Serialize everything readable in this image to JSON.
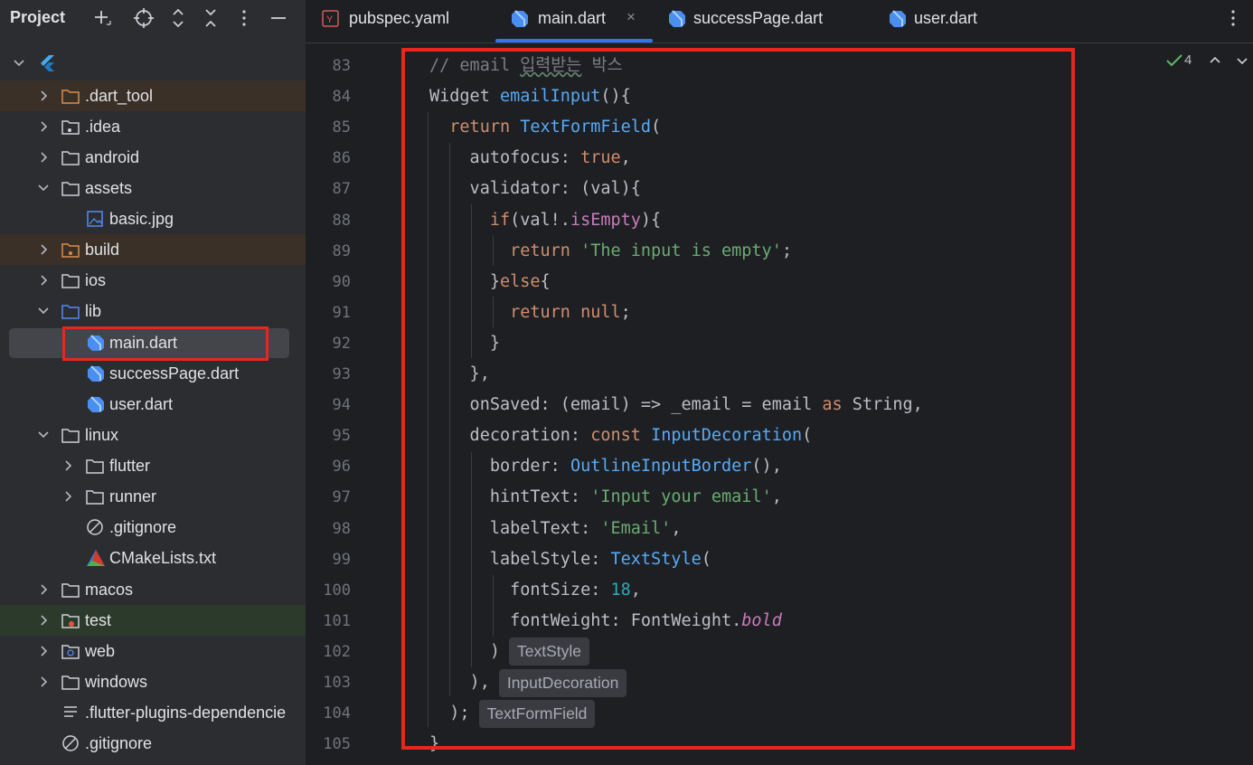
{
  "project_panel": {
    "title": "Project",
    "header_icons": [
      "add-icon",
      "target-icon",
      "expand-icon",
      "collapse-icon",
      "more-vertical-icon",
      "minimize-icon"
    ],
    "tree": [
      {
        "label": "",
        "icon": "flutter-icon",
        "expanded": true
      },
      {
        "label": ".dart_tool",
        "icon": "folder-excluded-icon",
        "expanded": false
      },
      {
        "label": ".idea",
        "icon": "folder-settings-icon",
        "expanded": false
      },
      {
        "label": "android",
        "icon": "folder-icon",
        "expanded": false
      },
      {
        "label": "assets",
        "icon": "folder-icon",
        "expanded": true
      },
      {
        "label": "basic.jpg",
        "icon": "image-file-icon"
      },
      {
        "label": "build",
        "icon": "folder-excluded-icon",
        "expanded": false
      },
      {
        "label": "ios",
        "icon": "folder-icon",
        "expanded": false
      },
      {
        "label": "lib",
        "icon": "folder-source-icon",
        "expanded": true
      },
      {
        "label": "main.dart",
        "icon": "dart-file-icon",
        "selected": true
      },
      {
        "label": "successPage.dart",
        "icon": "dart-file-icon"
      },
      {
        "label": "user.dart",
        "icon": "dart-file-icon"
      },
      {
        "label": "linux",
        "icon": "folder-icon",
        "expanded": true
      },
      {
        "label": "flutter",
        "icon": "folder-icon",
        "expanded": false
      },
      {
        "label": "runner",
        "icon": "folder-icon",
        "expanded": false
      },
      {
        "label": ".gitignore",
        "icon": "ignore-file-icon"
      },
      {
        "label": "CMakeLists.txt",
        "icon": "cmake-file-icon"
      },
      {
        "label": "macos",
        "icon": "folder-icon",
        "expanded": false
      },
      {
        "label": "test",
        "icon": "folder-test-icon",
        "expanded": false
      },
      {
        "label": "web",
        "icon": "folder-web-icon",
        "expanded": false
      },
      {
        "label": "windows",
        "icon": "folder-icon",
        "expanded": false
      },
      {
        "label": ".flutter-plugins-dependencie",
        "icon": "text-file-icon"
      },
      {
        "label": ".gitignore",
        "icon": "ignore-file-icon"
      }
    ]
  },
  "editor": {
    "tabs": [
      {
        "label": "pubspec.yaml",
        "icon": "yaml-file-icon",
        "active": false
      },
      {
        "label": "main.dart",
        "icon": "dart-file-icon",
        "active": true,
        "close": "×"
      },
      {
        "label": "successPage.dart",
        "icon": "dart-file-icon",
        "active": false
      },
      {
        "label": "user.dart",
        "icon": "dart-file-icon",
        "active": false
      }
    ],
    "inspection_count": "4",
    "code": [
      {
        "n": "83",
        "t": "// email 입력받는 박스"
      },
      {
        "n": "84",
        "t": "Widget emailInput(){"
      },
      {
        "n": "85",
        "t": "  return TextFormField("
      },
      {
        "n": "86",
        "t": "    autofocus: true,"
      },
      {
        "n": "87",
        "t": "    validator: (val){"
      },
      {
        "n": "88",
        "t": "      if(val!.isEmpty){"
      },
      {
        "n": "89",
        "t": "        return 'The input is empty';"
      },
      {
        "n": "90",
        "t": "      }else{"
      },
      {
        "n": "91",
        "t": "        return null;"
      },
      {
        "n": "92",
        "t": "      }"
      },
      {
        "n": "93",
        "t": "    },"
      },
      {
        "n": "94",
        "t": "    onSaved: (email) => _email = email as String,"
      },
      {
        "n": "95",
        "t": "    decoration: const InputDecoration("
      },
      {
        "n": "96",
        "t": "      border: OutlineInputBorder(),"
      },
      {
        "n": "97",
        "t": "      hintText: 'Input your email',"
      },
      {
        "n": "98",
        "t": "      labelText: 'Email',"
      },
      {
        "n": "99",
        "t": "      labelStyle: TextStyle("
      },
      {
        "n": "100",
        "t": "        fontSize: 18,"
      },
      {
        "n": "101",
        "t": "        fontWeight: FontWeight.bold"
      },
      {
        "n": "102",
        "t": "      )",
        "hint": "TextStyle"
      },
      {
        "n": "103",
        "t": "    ),",
        "hint": "InputDecoration"
      },
      {
        "n": "104",
        "t": "  );",
        "hint": "TextFormField"
      },
      {
        "n": "105",
        "t": "}"
      }
    ]
  },
  "colors": {
    "highlight_box": "#e5281d",
    "keyword": "#cf8e6d",
    "function": "#56a8f5",
    "string": "#6aab73",
    "number": "#2aacb8",
    "comment": "#7a7e85",
    "property": "#c77dbb",
    "active_tab_underline": "#3574f0"
  }
}
